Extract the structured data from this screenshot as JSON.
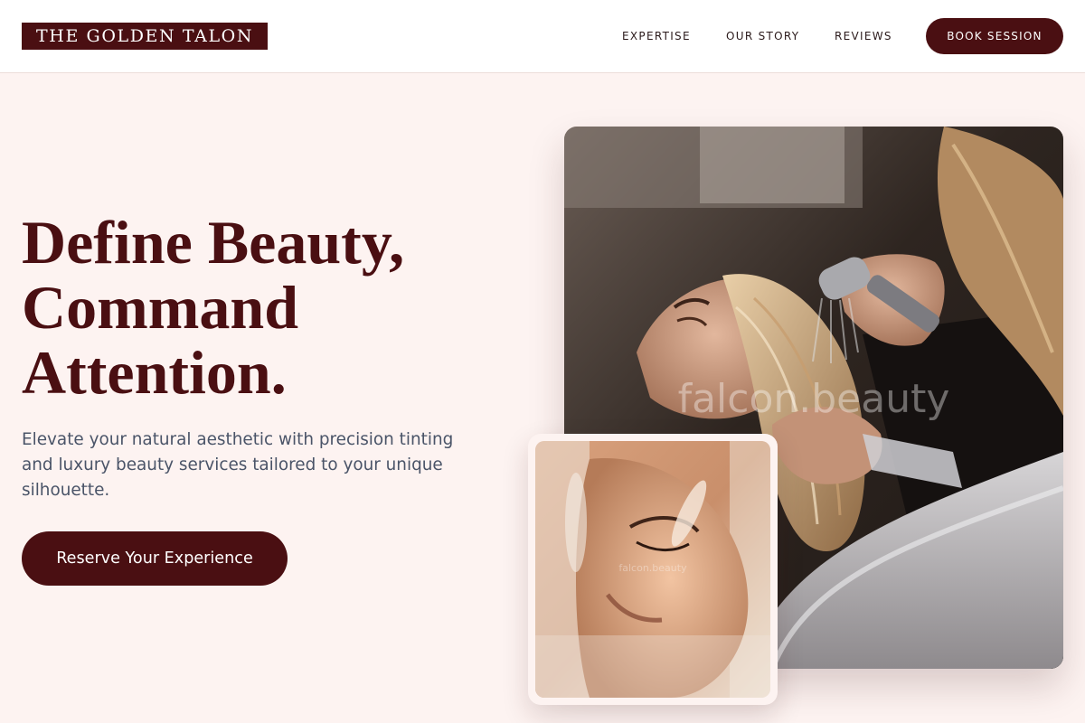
{
  "brand": {
    "name": "THE GOLDEN TALON"
  },
  "nav": {
    "links": [
      "EXPERTISE",
      "OUR STORY",
      "REVIEWS"
    ],
    "cta_label": "BOOK SESSION"
  },
  "hero": {
    "title_lines": [
      "Define Beauty,",
      "Command",
      "Attention."
    ],
    "subtitle": "Elevate your natural aesthetic with precision tinting and luxury beauty services tailored to your unique silhouette.",
    "cta_label": "Reserve Your Experience"
  },
  "images": {
    "main": {
      "watermark": "falcon.beauty"
    },
    "secondary": {
      "watermark": "falcon.beauty"
    }
  },
  "colors": {
    "brand": "#4a0f12",
    "background": "#fdf3f1",
    "body_text": "#4a5468"
  }
}
